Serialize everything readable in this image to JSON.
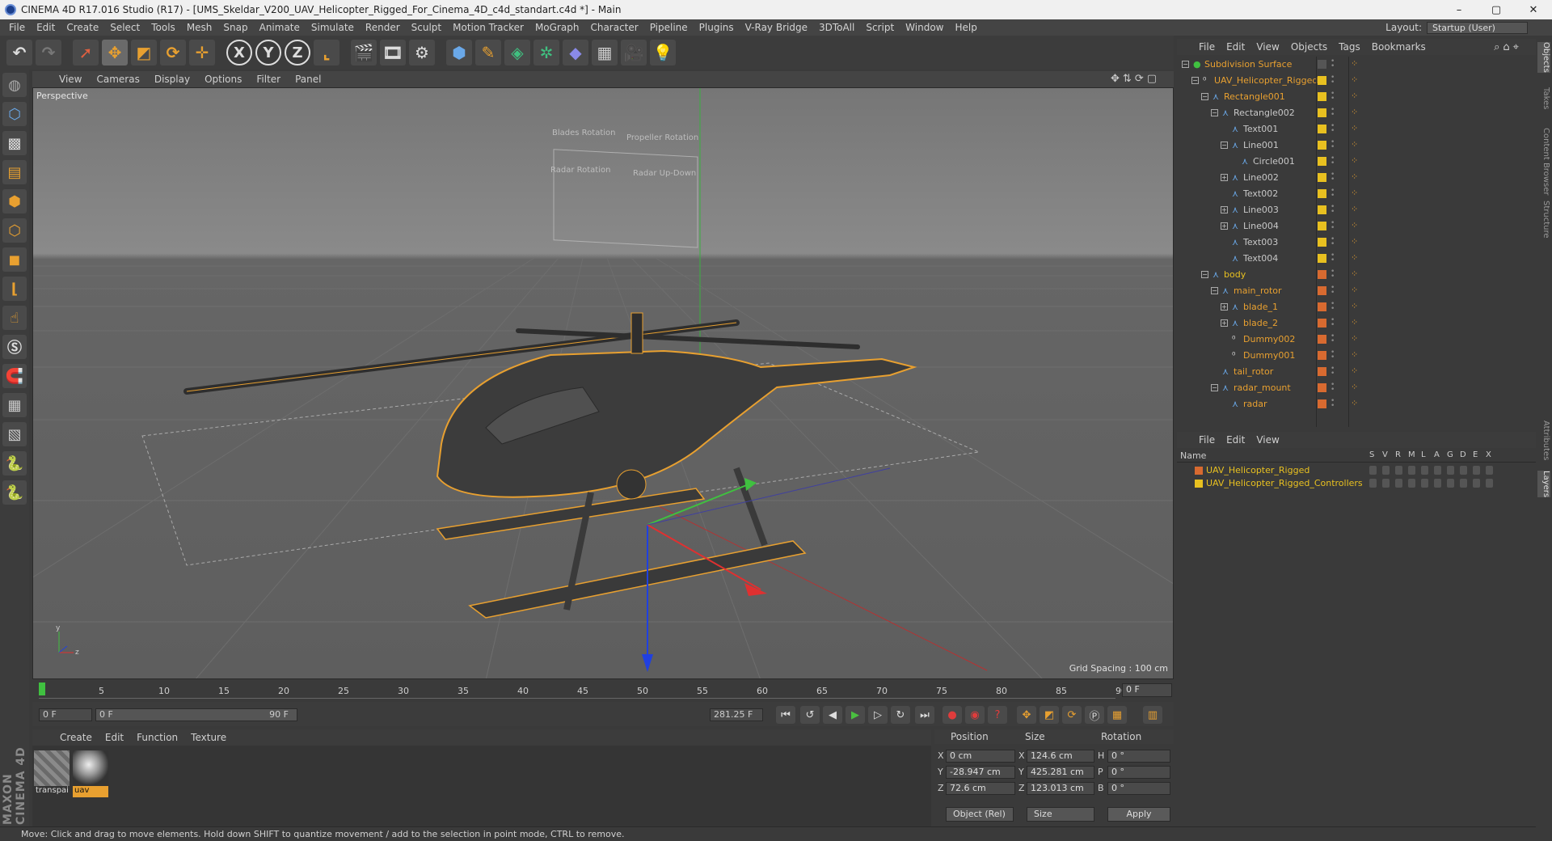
{
  "window": {
    "title": "CINEMA 4D R17.016 Studio (R17) - [UMS_Skeldar_V200_UAV_Helicopter_Rigged_For_Cinema_4D_c4d_standart.c4d *] - Main",
    "minimize": "–",
    "maximize": "▢",
    "close": "✕"
  },
  "menubar": [
    "File",
    "Edit",
    "Create",
    "Select",
    "Tools",
    "Mesh",
    "Snap",
    "Animate",
    "Simulate",
    "Render",
    "Sculpt",
    "Motion Tracker",
    "MoGraph",
    "Character",
    "Pipeline",
    "Plugins",
    "V-Ray Bridge",
    "3DToAll",
    "Script",
    "Window",
    "Help"
  ],
  "layout": {
    "label": "Layout:",
    "value": "Startup (User)"
  },
  "viewport": {
    "menu": [
      "View",
      "Cameras",
      "Display",
      "Options",
      "Filter",
      "Panel"
    ],
    "camera": "Perspective",
    "grid_spacing": "Grid Spacing : 100 cm",
    "overlay_labels": [
      "Blades Rotation",
      "Propeller Rotation",
      "Radar Rotation",
      "Radar Up-Down"
    ]
  },
  "timeline": {
    "ticks": [
      "0",
      "5",
      "10",
      "15",
      "20",
      "25",
      "30",
      "35",
      "40",
      "45",
      "50",
      "55",
      "60",
      "65",
      "70",
      "75",
      "80",
      "85",
      "90"
    ],
    "current_frame": "0 F"
  },
  "transport": {
    "start": "0 F",
    "range_start": "0 F",
    "range_end": "90 F",
    "end": "281.25 F"
  },
  "material_manager": {
    "menu": [
      "Create",
      "Edit",
      "Function",
      "Texture"
    ],
    "materials": [
      {
        "name": "transpai",
        "selected": false
      },
      {
        "name": "uav",
        "selected": true
      }
    ]
  },
  "coordinates": {
    "headers": {
      "position": "Position",
      "size": "Size",
      "rotation": "Rotation"
    },
    "rows": [
      {
        "axis": "X",
        "pos": "0 cm",
        "size_axis": "X",
        "size": "124.6 cm",
        "rot_axis": "H",
        "rot": "0 °"
      },
      {
        "axis": "Y",
        "pos": "-28.947 cm",
        "size_axis": "Y",
        "size": "425.281 cm",
        "rot_axis": "P",
        "rot": "0 °"
      },
      {
        "axis": "Z",
        "pos": "72.6 cm",
        "size_axis": "Z",
        "size": "123.013 cm",
        "rot_axis": "B",
        "rot": "0 °"
      }
    ],
    "mode": "Object (Rel)",
    "size_mode": "Size",
    "apply": "Apply"
  },
  "status": "Move: Click and drag to move elements. Hold down SHIFT to quantize movement / add to the selection in point mode, CTRL to remove.",
  "object_manager": {
    "menu": [
      "File",
      "Edit",
      "View",
      "Objects",
      "Tags",
      "Bookmarks"
    ],
    "objects": [
      {
        "name": "Subdivision Surface",
        "depth": 0,
        "expand": "−",
        "color": "#e8a030",
        "layer": "#555555",
        "icon": "green"
      },
      {
        "name": "UAV_Helicopter_Rigged",
        "depth": 1,
        "expand": "−",
        "color": "#e8a030",
        "layer": "#e8c020",
        "icon": "null"
      },
      {
        "name": "Rectangle001",
        "depth": 2,
        "expand": "−",
        "color": "#e8a030",
        "layer": "#e8c020",
        "icon": "spline"
      },
      {
        "name": "Rectangle002",
        "depth": 3,
        "expand": "−",
        "color": "#c8c8c8",
        "layer": "#e8c020",
        "icon": "spline"
      },
      {
        "name": "Text001",
        "depth": 4,
        "expand": "",
        "color": "#c8c8c8",
        "layer": "#e8c020",
        "icon": "spline"
      },
      {
        "name": "Line001",
        "depth": 4,
        "expand": "−",
        "color": "#c8c8c8",
        "layer": "#e8c020",
        "icon": "spline"
      },
      {
        "name": "Circle001",
        "depth": 5,
        "expand": "",
        "color": "#c8c8c8",
        "layer": "#e8c020",
        "icon": "spline"
      },
      {
        "name": "Line002",
        "depth": 4,
        "expand": "+",
        "color": "#c8c8c8",
        "layer": "#e8c020",
        "icon": "spline"
      },
      {
        "name": "Text002",
        "depth": 4,
        "expand": "",
        "color": "#c8c8c8",
        "layer": "#e8c020",
        "icon": "spline"
      },
      {
        "name": "Line003",
        "depth": 4,
        "expand": "+",
        "color": "#c8c8c8",
        "layer": "#e8c020",
        "icon": "spline"
      },
      {
        "name": "Line004",
        "depth": 4,
        "expand": "+",
        "color": "#c8c8c8",
        "layer": "#e8c020",
        "icon": "spline"
      },
      {
        "name": "Text003",
        "depth": 4,
        "expand": "",
        "color": "#c8c8c8",
        "layer": "#e8c020",
        "icon": "spline"
      },
      {
        "name": "Text004",
        "depth": 4,
        "expand": "",
        "color": "#c8c8c8",
        "layer": "#e8c020",
        "icon": "spline"
      },
      {
        "name": "body",
        "depth": 2,
        "expand": "−",
        "color": "#e8c020",
        "layer": "#d86a30",
        "icon": "poly"
      },
      {
        "name": "main_rotor",
        "depth": 3,
        "expand": "−",
        "color": "#e8a030",
        "layer": "#d86a30",
        "icon": "poly"
      },
      {
        "name": "blade_1",
        "depth": 4,
        "expand": "+",
        "color": "#e8a030",
        "layer": "#d86a30",
        "icon": "poly"
      },
      {
        "name": "blade_2",
        "depth": 4,
        "expand": "+",
        "color": "#e8a030",
        "layer": "#d86a30",
        "icon": "poly"
      },
      {
        "name": "Dummy002",
        "depth": 4,
        "expand": "",
        "color": "#e8a030",
        "layer": "#d86a30",
        "icon": "null"
      },
      {
        "name": "Dummy001",
        "depth": 4,
        "expand": "",
        "color": "#e8a030",
        "layer": "#d86a30",
        "icon": "null"
      },
      {
        "name": "tail_rotor",
        "depth": 3,
        "expand": "",
        "color": "#e8a030",
        "layer": "#d86a30",
        "icon": "poly"
      },
      {
        "name": "radar_mount",
        "depth": 3,
        "expand": "−",
        "color": "#e8a030",
        "layer": "#d86a30",
        "icon": "poly"
      },
      {
        "name": "radar",
        "depth": 4,
        "expand": "",
        "color": "#e8a030",
        "layer": "#d86a30",
        "icon": "poly"
      }
    ]
  },
  "layer_manager": {
    "menu": [
      "File",
      "Edit",
      "View"
    ],
    "name_header": "Name",
    "flags": [
      "S",
      "V",
      "R",
      "M",
      "L",
      "A",
      "G",
      "D",
      "E",
      "X"
    ],
    "layers": [
      {
        "name": "UAV_Helicopter_Rigged",
        "color": "#d86a30"
      },
      {
        "name": "UAV_Helicopter_Rigged_Controllers",
        "color": "#e8c020"
      }
    ]
  },
  "side_tabs": [
    "Objects",
    "Takes",
    "Content Browser",
    "Structure",
    "Attributes",
    "Layers"
  ],
  "brand": "MAXON CINEMA 4D"
}
